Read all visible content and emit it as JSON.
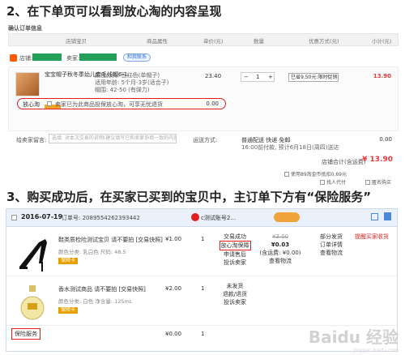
{
  "headings": {
    "step2": "2、在下单页可以看到放心淘的内容呈现",
    "step3": "3、购买成功后，在买家已买到的宝贝中，主订单下方有“保险服务”"
  },
  "confirm": {
    "title": "确认订单信息",
    "columns": [
      "店铺宝贝",
      "商品属性",
      "单价(元)",
      "数量",
      "优惠方式(元)",
      "小计(元)"
    ],
    "shop_label": "店铺:",
    "seller_label": "卖家:",
    "seller_chat": "和我联系",
    "item": {
      "name": "宝宝帽子秋冬季幼儿套毛线帽6-1…",
      "attrs": [
        "颜色分类: 豆红色(单帽子)",
        "适用年龄: 5个月-3岁(适合子)",
        "帽围: 42-50 (有弹力)"
      ],
      "price": "23.40",
      "qty": "1",
      "promo": "已省9.50元:限时促销",
      "subtotal": "13.90"
    },
    "insurance": {
      "label": "放心淘",
      "text": "卖家已为此商品投保放心淘，可享无忧退货",
      "price": "0.00"
    },
    "message": {
      "label": "给卖家留言:",
      "placeholder": "选填: 对本次交易的说明(建议填写已和卖家协商一致的内容)"
    },
    "shipping": {
      "label": "运送方式:",
      "value": "普通配送 快递 免邮",
      "note": "16:00前付款, 预计6月18日(周四)送达",
      "price": "0.00"
    },
    "total_label": "店铺合计(含运费)",
    "total": "¥ 13.90",
    "opt_pay": "使用89淘金币抵扣0.69元",
    "opt_friend": "找人代付",
    "opt_anon": "匿名购买"
  },
  "order": {
    "date": "2016-07-19",
    "order_no": "订单号: 2089554262393442",
    "shop": "c测试账号2...",
    "items": [
      {
        "name": "鞋类质检险测试宝贝 请不要拍 [交易快照]",
        "attrs": "颜色分类: 乳白色  尺码: 48.5",
        "badge": "保障卡",
        "price": "¥1.00",
        "qty": "1",
        "status": [
          "交易成功"
        ],
        "status_highlight": "放心淘保障",
        "status_more": [
          "申请售后",
          "投诉卖家"
        ],
        "original": "¥3.00",
        "pay": "¥0.03",
        "pay_note": "(含运费: ¥0.00)",
        "pay_more": "查看物流",
        "ops": [
          "部分发货",
          "订单详情",
          "查看物流"
        ],
        "remind": "提醒买家收货"
      },
      {
        "name": "香水测试商品 请不要拍 [交易快照]",
        "attrs": "颜色分类: 白色  净含量: 125mL",
        "badge": "保障卡",
        "price": "¥2.00",
        "qty": "1",
        "status": [
          "未发货",
          "退款/退货",
          "投诉卖家"
        ]
      }
    ],
    "insurance_row": {
      "label": "保险服务",
      "price": "¥0.00",
      "qty": "1"
    }
  },
  "watermark": "Baidu 经验",
  "watermark_sub": "jingyan.baidu.com"
}
